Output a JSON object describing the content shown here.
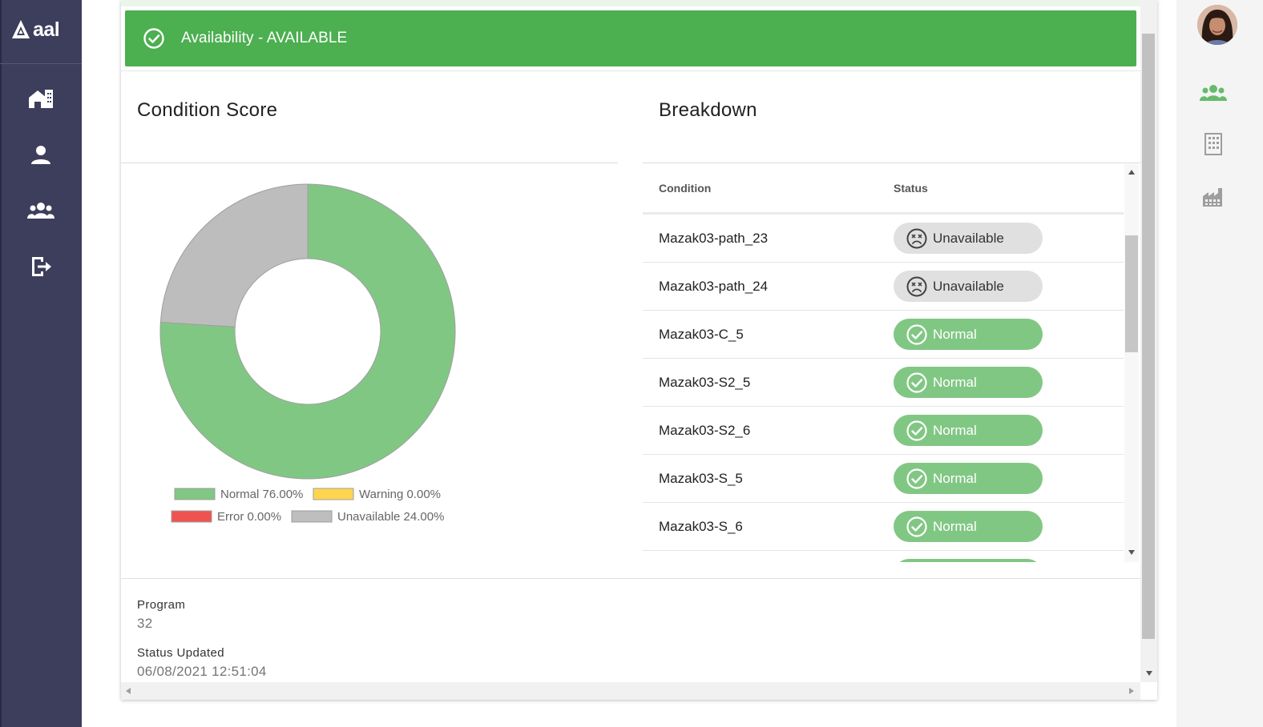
{
  "app": {
    "logo_text": "aal"
  },
  "sidebar": {
    "items": [
      {
        "name": "home",
        "icon": "home-building-icon"
      },
      {
        "name": "user",
        "icon": "person-icon"
      },
      {
        "name": "groups",
        "icon": "people-group-icon"
      },
      {
        "name": "logout",
        "icon": "logout-icon"
      }
    ]
  },
  "right_rail": {
    "avatar": "user-avatar",
    "items": [
      {
        "name": "team",
        "icon": "people-group-icon",
        "active": true
      },
      {
        "name": "building",
        "icon": "building-icon"
      },
      {
        "name": "factory",
        "icon": "factory-icon"
      }
    ]
  },
  "banner": {
    "text": "Availability - AVAILABLE",
    "color": "#4caf50"
  },
  "condition_score": {
    "title": "Condition Score",
    "chart_data": {
      "type": "pie",
      "donut": true,
      "slices": [
        {
          "label": "Normal",
          "value": 76.0,
          "color": "#81c784"
        },
        {
          "label": "Warning",
          "value": 0.0,
          "color": "#ffd54f"
        },
        {
          "label": "Error",
          "value": 0.0,
          "color": "#ef5350"
        },
        {
          "label": "Unavailable",
          "value": 24.0,
          "color": "#bdbdbd"
        }
      ],
      "legend": [
        {
          "text": "Normal 76.00%",
          "color": "#81c784"
        },
        {
          "text": "Warning 0.00%",
          "color": "#ffd54f"
        },
        {
          "text": "Error 0.00%",
          "color": "#ef5350"
        },
        {
          "text": "Unavailable 24.00%",
          "color": "#bdbdbd"
        }
      ],
      "legend_placement": "bottom"
    }
  },
  "breakdown": {
    "title": "Breakdown",
    "columns": [
      "Condition",
      "Status"
    ],
    "rows": [
      {
        "condition": "Mazak03-path_23",
        "status": "Unavailable"
      },
      {
        "condition": "Mazak03-path_24",
        "status": "Unavailable"
      },
      {
        "condition": "Mazak03-C_5",
        "status": "Normal"
      },
      {
        "condition": "Mazak03-S2_5",
        "status": "Normal"
      },
      {
        "condition": "Mazak03-S2_6",
        "status": "Normal"
      },
      {
        "condition": "Mazak03-S_5",
        "status": "Normal"
      },
      {
        "condition": "Mazak03-S_6",
        "status": "Normal"
      },
      {
        "condition": "",
        "status": "Normal"
      }
    ]
  },
  "details": {
    "program_label": "Program",
    "program_value": "32",
    "status_updated_label": "Status Updated",
    "status_updated_value": "06/08/2021 12:51:04"
  }
}
